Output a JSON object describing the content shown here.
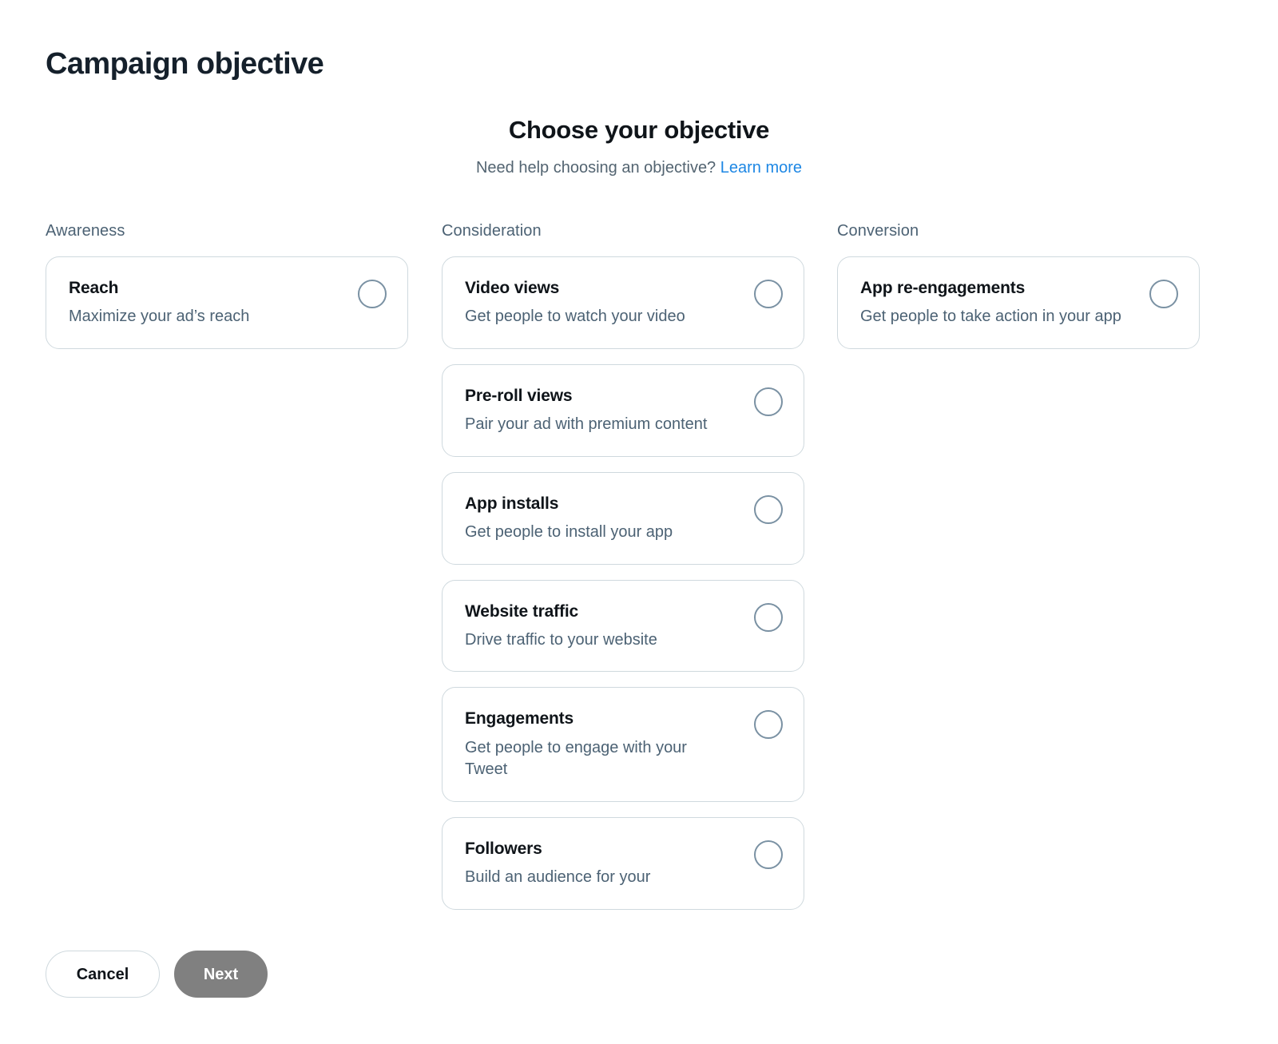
{
  "page": {
    "title": "Campaign objective"
  },
  "heading": {
    "title": "Choose your objective",
    "subtitle_text": "Need help choosing an objective?",
    "link_label": "Learn more"
  },
  "colors": {
    "link_blue": "#1d87e4",
    "text_primary": "#0f1419",
    "text_secondary": "#4c6274",
    "card_border": "#cfd9de",
    "radio_border": "#7a91a3",
    "next_disabled": "#808080"
  },
  "columns": [
    {
      "label": "Awareness",
      "options": [
        {
          "name": "Reach",
          "description": "Maximize your ad’s reach",
          "selected": false
        }
      ]
    },
    {
      "label": "Consideration",
      "options": [
        {
          "name": "Video views",
          "description": "Get people to watch your video",
          "selected": false
        },
        {
          "name": "Pre-roll views",
          "description": "Pair your ad with premium content",
          "selected": false
        },
        {
          "name": "App installs",
          "description": "Get people to install your app",
          "selected": false
        },
        {
          "name": "Website traffic",
          "description": "Drive traffic to your website",
          "selected": false
        },
        {
          "name": "Engagements",
          "description": "Get people to engage with your Tweet",
          "selected": false
        },
        {
          "name": "Followers",
          "description": "Build an audience for your",
          "selected": false
        }
      ]
    },
    {
      "label": "Conversion",
      "options": [
        {
          "name": "App re-engagements",
          "description": "Get people to take action in your app",
          "selected": false
        }
      ]
    }
  ],
  "footer": {
    "cancel_label": "Cancel",
    "next_label": "Next"
  }
}
